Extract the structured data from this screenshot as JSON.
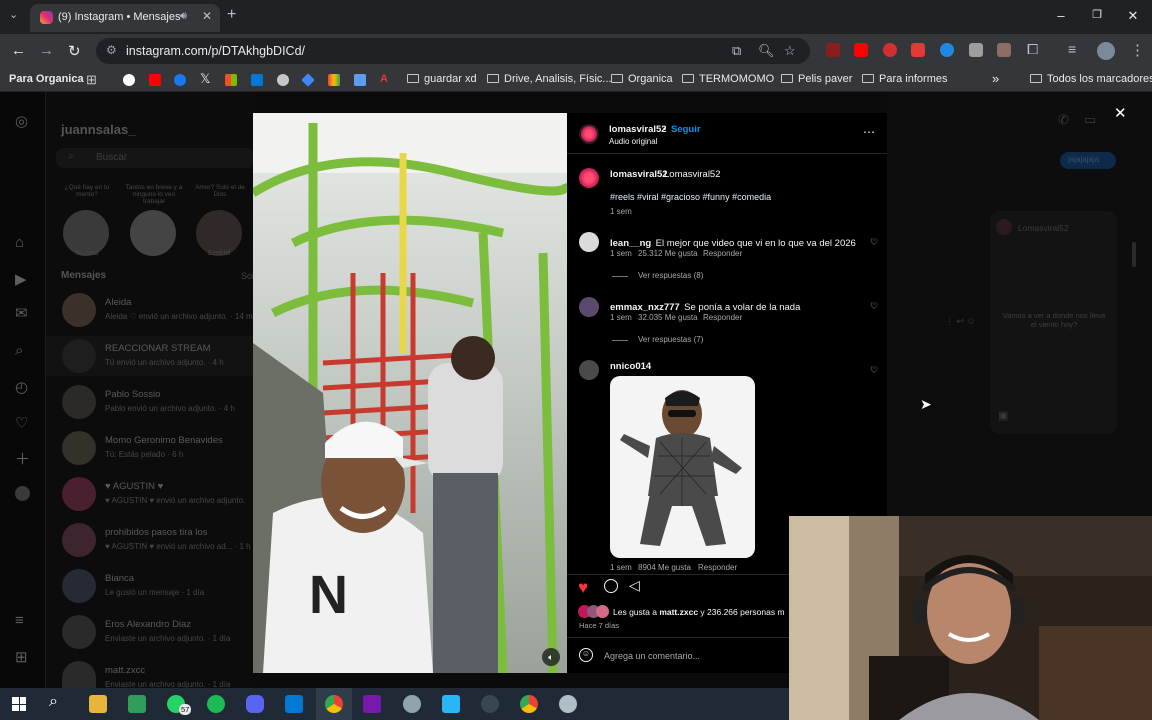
{
  "browser": {
    "tab_title": "(9) Instagram • Mensajes",
    "url": "instagram.com/p/DTAkhgbDICd/",
    "new_tab": "+",
    "win_min": "–",
    "win_max": "❐",
    "win_close": "✕"
  },
  "bookmarks": {
    "profile": "Para Organica",
    "items": [
      "guardar xd",
      "Drive, Analisis, Físic...",
      "Organica",
      "TERMOMOMO",
      "Pelis paver",
      "Para informes"
    ],
    "more": "»",
    "all": "Todos los marcadores"
  },
  "sidebar": {
    "username": "juannsalas_",
    "search_placeholder": "Buscar",
    "notes": [
      "¿Qué hay en tu mente?",
      "Tantos en breve y a ninguno lo veo trabajar",
      "Amor? Solo el de Dios"
    ],
    "note_names": [
      "Tu nota",
      "</3",
      "Ezekiel"
    ],
    "messages_header": "Mensajes",
    "requests_label": "Sol",
    "chats": [
      {
        "name": "Aleida",
        "sub": "Aleida ♡ envió un archivo adjunto. · 14 m"
      },
      {
        "name": "REACCIONAR STREAM",
        "sub": "Tú envió un archivo adjunto. · 4 h"
      },
      {
        "name": "Pablo Sossio",
        "sub": "Pablo envió un archivo adjunto. · 4 h"
      },
      {
        "name": "Momo Geronimo Benavides",
        "sub": "Tú: Estás pelado · 6 h"
      },
      {
        "name": "♥ AGUSTIN ♥",
        "sub": "♥ AGUSTIN ♥ envió un archivo adjunto."
      },
      {
        "name": "prohibidos pasos tira los",
        "sub": "♥ AGUSTIN ♥ envió un archivo ad... · 1 h"
      },
      {
        "name": "Bianca",
        "sub": "Le gustó un mensaje · 1 día"
      },
      {
        "name": "Eros Alexandro Diaz",
        "sub": "Enviaste un archivo adjunto. · 1 día"
      },
      {
        "name": "matt.zxcc",
        "sub": "Enviaste un archivo adjunto. · 1 día"
      }
    ]
  },
  "right_pane": {
    "bubble": "jajajajaja",
    "contact": "Lomasviral52",
    "shared_text": "Vamos a ver a donde nos lleva el viento hoy?"
  },
  "post": {
    "author": "lomasviral52",
    "follow": "Seguir",
    "audio": "Audio original",
    "caption_user": "lomasviral52",
    "caption": "Lomasviral52",
    "hashtags": "#reels #viral #gracioso #funny #comedia",
    "caption_time": "1 sem",
    "comments": [
      {
        "user": "lean__ng",
        "text": "El mejor que video que vi en lo que va del 2026",
        "time": "1 sem",
        "likes": "25.312 Me gusta",
        "reply": "Responder",
        "replies": "Ver respuestas (8)"
      },
      {
        "user": "emmax_nxz777",
        "text": "Se ponía a volar de la nada",
        "time": "1 sem",
        "likes": "32.035 Me gusta",
        "reply": "Responder",
        "replies": "Ver respuestas (7)"
      },
      {
        "user": "nnico014",
        "text": "",
        "time": "1 sem",
        "likes": "8904 Me gusta",
        "reply": "Responder"
      }
    ],
    "likes_text_prefix": "Les gusta a ",
    "likes_user": "matt.zxcc",
    "likes_text_suffix": " y 236.266 personas m",
    "date": "Hace 7 días",
    "comment_placeholder": "Agrega un comentario..."
  },
  "taskbar": {
    "whatsapp_badge": "57"
  },
  "colors": {
    "accent": "#0095f6",
    "like_red": "#ff3040"
  }
}
